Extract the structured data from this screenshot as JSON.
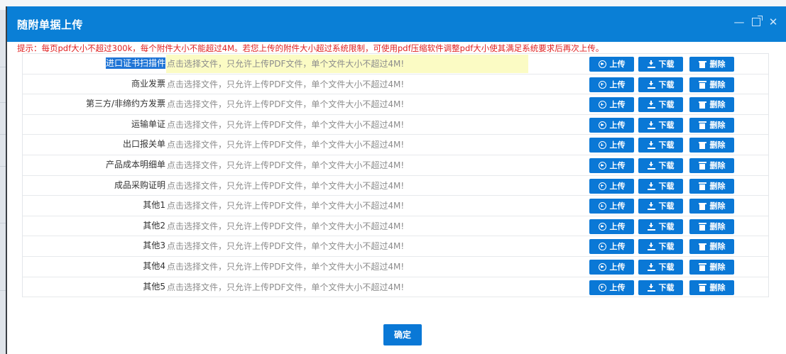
{
  "dialog": {
    "title": "随附单据上传",
    "hint": "提示：每页pdf大小不超过300k，每个附件大小不能超过4M。若您上传的附件大小超过系统限制，可使用pdf压缩软件调整pdf大小使其满足系统要求后再次上传。",
    "controls": {
      "minimize": "—",
      "maximize": "",
      "close": "✕"
    },
    "file_placeholder": "点击选择文件，只允许上传PDF文件，单个文件大小不超过4M!",
    "buttons": {
      "upload": "上传",
      "download": "下载",
      "delete": "删除"
    },
    "rows": [
      {
        "label": "进口证书扫描件",
        "selected": true
      },
      {
        "label": "商业发票"
      },
      {
        "label": "第三方/非缔约方发票"
      },
      {
        "label": "运输单证"
      },
      {
        "label": "出口报关单"
      },
      {
        "label": "产品成本明细单"
      },
      {
        "label": "成品采购证明"
      },
      {
        "label": "其他1"
      },
      {
        "label": "其他2"
      },
      {
        "label": "其他3"
      },
      {
        "label": "其他4"
      },
      {
        "label": "其他5"
      }
    ],
    "confirm": "确定"
  },
  "colors": {
    "primary": "#0a7fd6",
    "hint": "#e02020",
    "highlight": "#fbfbc4"
  },
  "icons": {
    "upload": "plus-circle-icon",
    "download": "download-icon",
    "delete": "trash-icon"
  }
}
